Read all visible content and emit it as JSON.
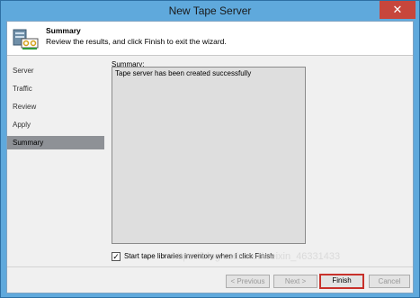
{
  "window": {
    "title": "New Tape Server",
    "close_glyph": "✕"
  },
  "header": {
    "icon": "tape-server-icon",
    "title": "Summary",
    "description": "Review the results, and click Finish to exit the wizard."
  },
  "nav": {
    "items": [
      {
        "label": "Server",
        "active": false
      },
      {
        "label": "Traffic",
        "active": false
      },
      {
        "label": "Review",
        "active": false
      },
      {
        "label": "Apply",
        "active": false
      },
      {
        "label": "Summary",
        "active": true
      }
    ]
  },
  "summary": {
    "label": "Summary:",
    "text": "Tape server has been created successfully"
  },
  "option": {
    "checked": true,
    "check_glyph": "✓",
    "label": "Start tape libraries inventory when I click Finish"
  },
  "buttons": {
    "previous": "< Previous",
    "next": "Next >",
    "finish": "Finish",
    "cancel": "Cancel"
  },
  "watermark": "https://blog.csdn.net/weixin_46331433",
  "colors": {
    "title_bar": "#5fa9dc",
    "close_button": "#c7463c",
    "selected_nav": "#8e9196",
    "focus_border": "#c8312b"
  }
}
